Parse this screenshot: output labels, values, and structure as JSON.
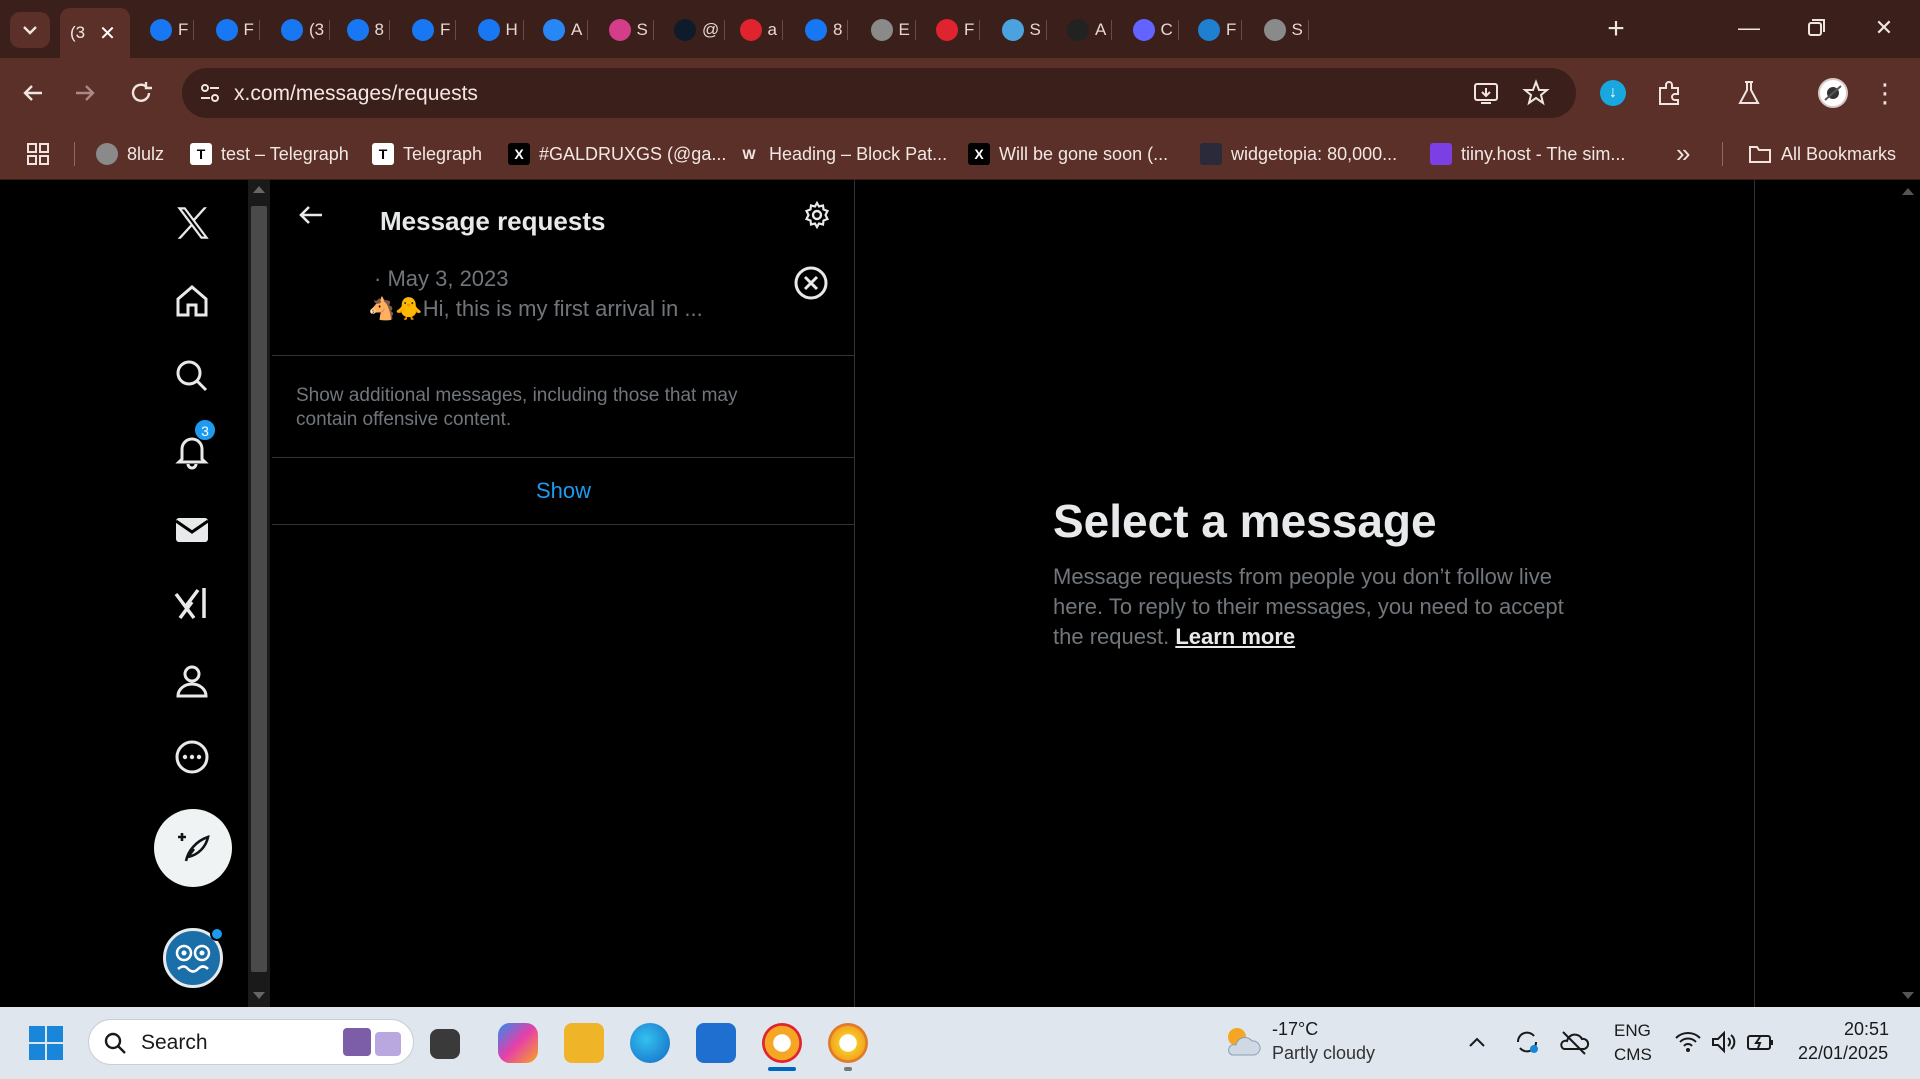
{
  "browser": {
    "tabs": [
      {
        "label": "(3",
        "icon": "x-logo",
        "color": "#ffffff"
      },
      {
        "label": "F",
        "icon": "facebook-icon",
        "color": "#1877f2"
      },
      {
        "label": "F",
        "icon": "facebook-icon",
        "color": "#1877f2"
      },
      {
        "label": "(3",
        "icon": "facebook-icon",
        "color": "#1877f2"
      },
      {
        "label": "8",
        "icon": "facebook-icon",
        "color": "#1877f2"
      },
      {
        "label": "F",
        "icon": "facebook-icon",
        "color": "#1877f2"
      },
      {
        "label": "H",
        "icon": "facebook-icon",
        "color": "#1877f2"
      },
      {
        "label": "A",
        "icon": "vk-icon",
        "color": "#2787f5"
      },
      {
        "label": "S",
        "icon": "tab-s-icon",
        "color": "#d43d8a"
      },
      {
        "label": "@",
        "icon": "tumblr-icon",
        "color": "#0d1b2a"
      },
      {
        "label": "a",
        "icon": "vivaldi-icon",
        "color": "#e0242f"
      },
      {
        "label": "8",
        "icon": "facebook-icon",
        "color": "#1877f2"
      },
      {
        "label": "E",
        "icon": "globe-icon",
        "color": "#8a8a8a"
      },
      {
        "label": "F",
        "icon": "tab-f-icon",
        "color": "#e0242f"
      },
      {
        "label": "S",
        "icon": "tab-atom-icon",
        "color": "#4aa3df"
      },
      {
        "label": "A",
        "icon": "tab-chat-icon",
        "color": "#222222"
      },
      {
        "label": "C",
        "icon": "mastodon-icon",
        "color": "#6364ff"
      },
      {
        "label": "F",
        "icon": "ch-icon",
        "color": "#1f7fd0"
      },
      {
        "label": "S",
        "icon": "globe-icon",
        "color": "#8a8a8a"
      }
    ],
    "url": "x.com/messages/requests",
    "bookmarks": [
      {
        "label": "8lulz",
        "icon": "globe-icon"
      },
      {
        "label": "test – Telegraph",
        "icon": "telegraph-icon",
        "letter": "T"
      },
      {
        "label": "Telegraph",
        "icon": "telegraph-icon",
        "letter": "T"
      },
      {
        "label": "#GALDRUXGS (@ga...",
        "icon": "x-logo-icon",
        "letter": "X"
      },
      {
        "label": "Heading – Block Pat...",
        "icon": "wordpress-icon",
        "letter": "W"
      },
      {
        "label": "Will be gone soon (...",
        "icon": "x-logo-icon",
        "letter": "X"
      },
      {
        "label": "widgetopia: 80,000...",
        "icon": "widgetopia-icon",
        "letter": ""
      },
      {
        "label": "tiiny.host - The sim...",
        "icon": "tiiny-icon",
        "letter": ""
      }
    ],
    "all_bookmarks": "All Bookmarks",
    "overflow": "»"
  },
  "x": {
    "notifications_badge": "3",
    "header_title": "Message requests",
    "request": {
      "date": "· May 3, 2023",
      "preview": "🐴🐥Hi, this is my first arrival in ..."
    },
    "additional_note": "Show additional messages, including those that may contain offensive content.",
    "show_label": "Show",
    "detail": {
      "title": "Select a message",
      "body": "Message requests from people you don’t follow live here. To reply to their messages, you need to accept the request.",
      "link": "Learn more"
    },
    "accent": "#1d9bf0"
  },
  "taskbar": {
    "search_placeholder": "Search",
    "weather_temp": "-17°C",
    "weather_desc": "Partly cloudy",
    "lang_top": "ENG",
    "lang_bottom": "CMS",
    "time": "20:51",
    "date": "22/01/2025"
  }
}
